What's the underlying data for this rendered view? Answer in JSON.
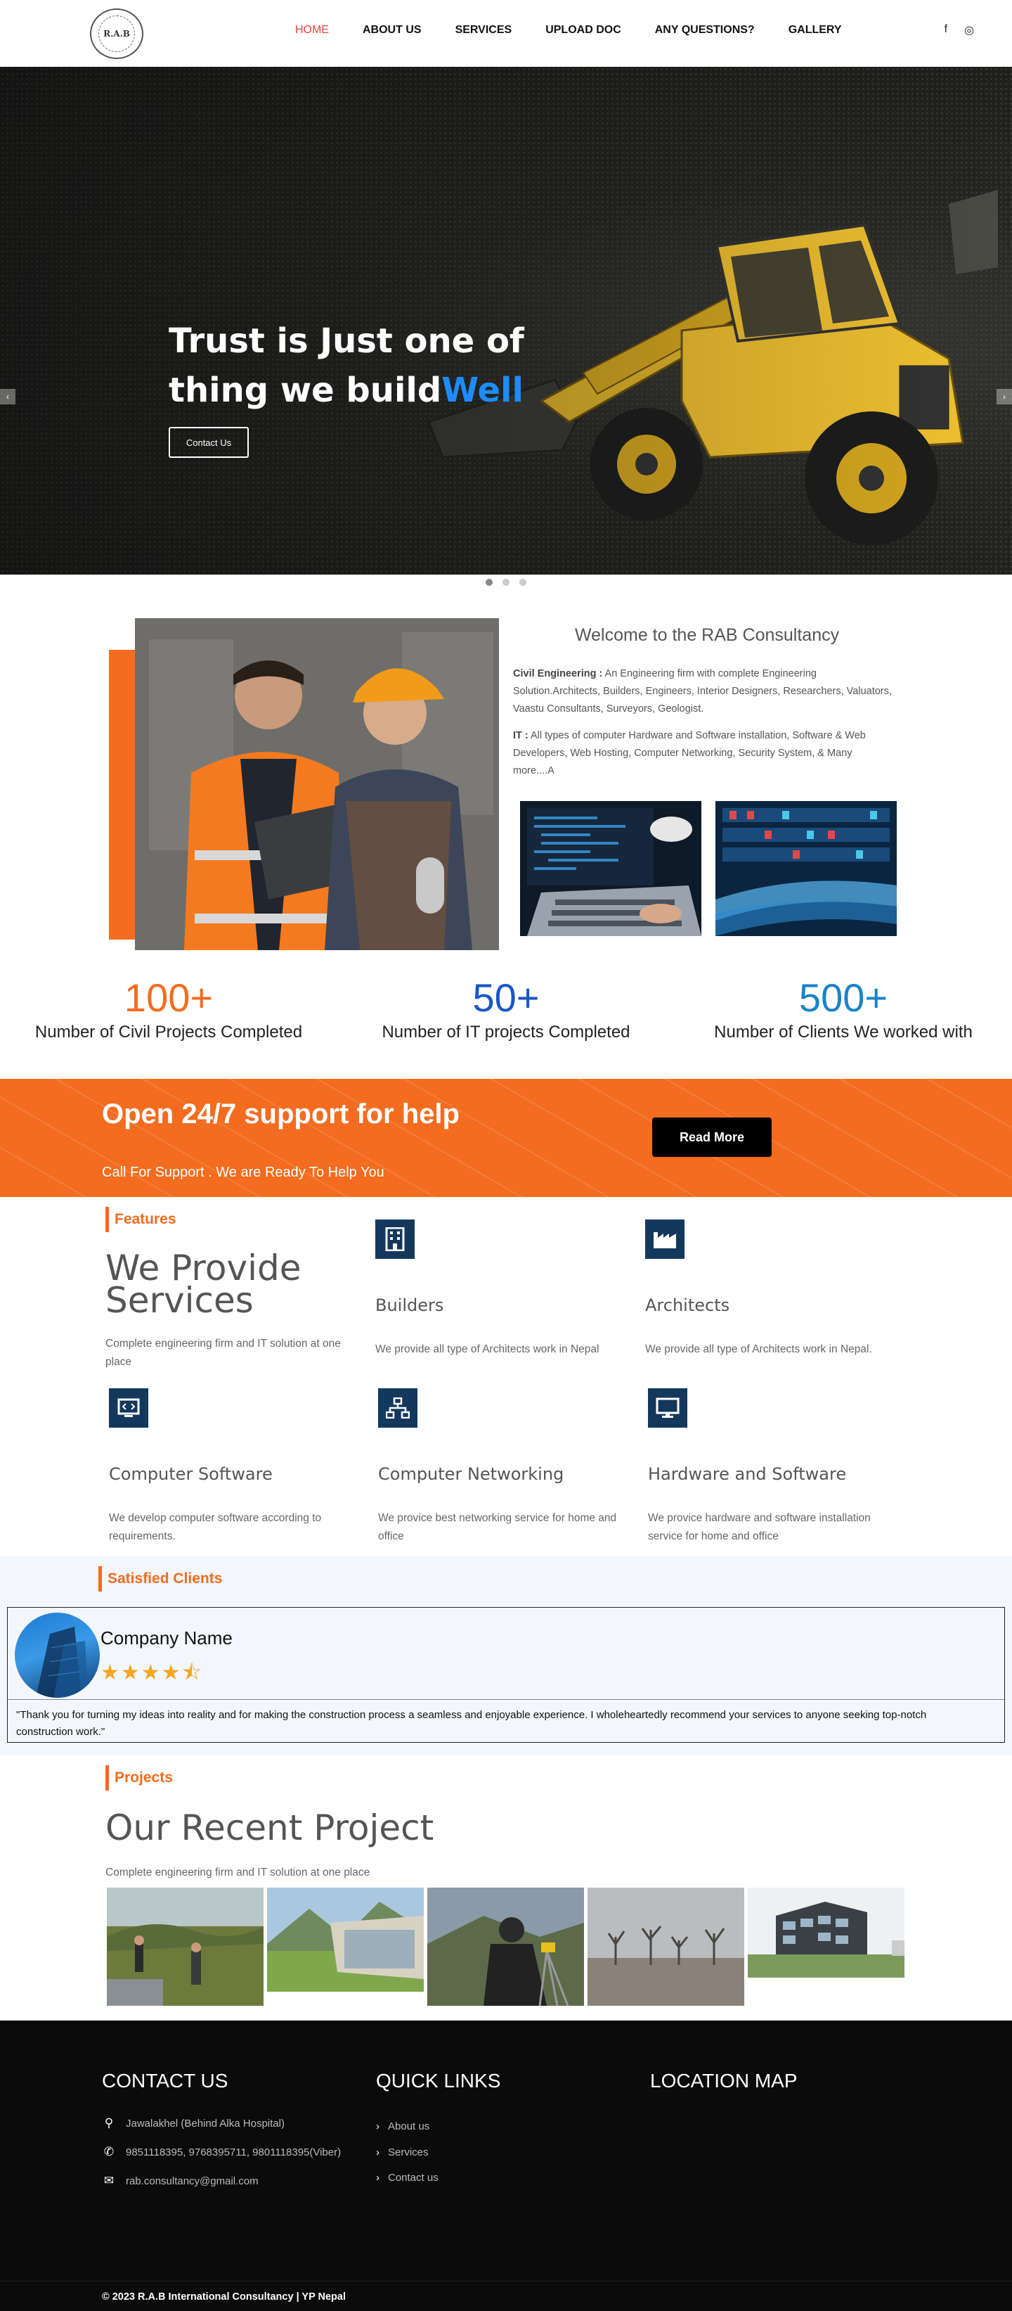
{
  "nav": {
    "logo_text": "R.A.B",
    "items": [
      "HOME",
      "ABOUT US",
      "SERVICES",
      "UPLOAD DOC",
      "ANY QUESTIONS?",
      "GALLERY"
    ],
    "social": [
      "f",
      "◎"
    ]
  },
  "hero": {
    "line1": "Trust is Just one of",
    "line2": "thing we build",
    "highlight": "Well",
    "cta": "Contact Us"
  },
  "welcome": {
    "title": "Welcome to the RAB Consultancy",
    "civil_label": "Civil Engineering :",
    "civil_text": " An Engineering firm with complete Engineering Solution.Architects, Builders, Engineers, Interior Designers, Researchers, Valuators, Vaastu Consultants, Surveyors, Geologist.",
    "it_label": "IT :",
    "it_text": "  All types of computer Hardware and Software installation, Software & Web Developers, Web Hosting, Computer Networking, Security System, & Many more....A"
  },
  "stats": [
    {
      "number": "100+",
      "label": "Number of Civil Projects Completed",
      "color": "#f36c1f"
    },
    {
      "number": "50+",
      "label": "Number of IT projects Completed",
      "color": "#1a56c8"
    },
    {
      "number": "500+",
      "label": "Number of Clients We worked with",
      "color": "#1a84c8"
    }
  ],
  "support": {
    "title": "Open 24/7 support for help",
    "subtitle": "Call For Support . We are Ready To Help You",
    "button": "Read More"
  },
  "features": {
    "tag": "Features",
    "title_line1": "We Provide",
    "title_line2": "Services",
    "desc": "Complete engineering firm and IT solution at one place",
    "services": [
      {
        "icon": "building-icon",
        "title": "Builders",
        "desc": "We provide all type of Architects work in Nepal"
      },
      {
        "icon": "factory-icon",
        "title": "Architects",
        "desc": "We provide all type of Architects work in Nepal."
      },
      {
        "icon": "code-icon",
        "title": "Computer Software",
        "desc": "We develop computer software according to requirements."
      },
      {
        "icon": "network-icon",
        "title": "Computer Networking",
        "desc": "We provice best networking service for home and office"
      },
      {
        "icon": "monitor-icon",
        "title": "Hardware and Software",
        "desc": "We provice hardware and software installation service for home and office"
      }
    ]
  },
  "clients": {
    "tag": "Satisfied Clients",
    "company": "Company Name",
    "rating": 4.5,
    "stars": "★★★★⯪",
    "quote": "\"Thank you for turning my ideas into reality and for making the construction process a seamless and enjoyable experience. I wholeheartedly recommend your services to anyone seeking top-notch construction work.\""
  },
  "projects": {
    "tag": "Projects",
    "title": "Our Recent Project",
    "desc": "Complete engineering firm and IT solution at one place"
  },
  "footer": {
    "contact_title": "CONTACT US",
    "links_title": "QUICK LINKS",
    "map_title": "LOCATION MAP",
    "address": "Jawalakhel (Behind Alka Hospital)",
    "phone": "9851118395, 9768395711, 9801118395(Viber)",
    "email": "rab.consultancy@gmail.com",
    "links": [
      "About us",
      "Services",
      "Contact us"
    ],
    "copyright": "© 2023 R.A.B International Consultancy | YP Nepal"
  },
  "colors": {
    "accent": "#f36c1f",
    "nav_active": "#e8453c",
    "hero_highlight": "#1d8cf8",
    "icon_bg": "#14385c"
  }
}
